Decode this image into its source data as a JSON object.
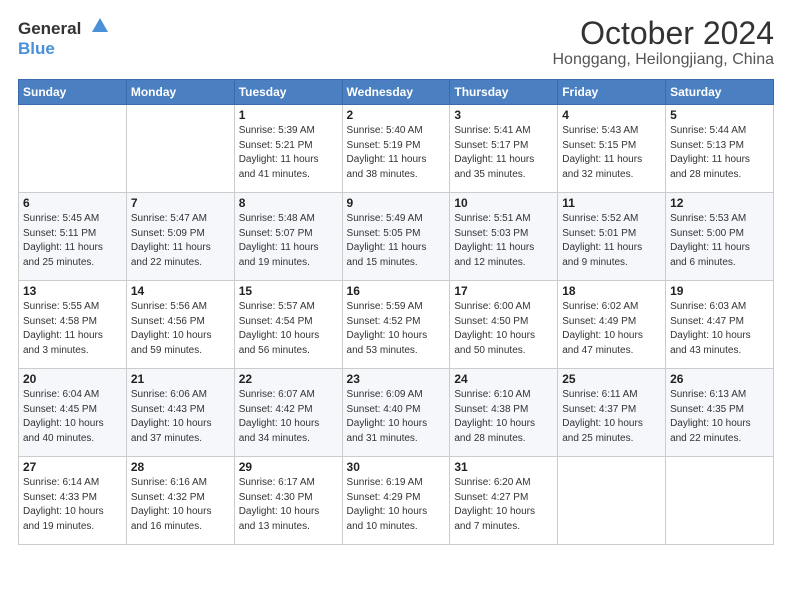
{
  "logo": {
    "text_general": "General",
    "text_blue": "Blue"
  },
  "title": "October 2024",
  "subtitle": "Honggang, Heilongjiang, China",
  "days_of_week": [
    "Sunday",
    "Monday",
    "Tuesday",
    "Wednesday",
    "Thursday",
    "Friday",
    "Saturday"
  ],
  "weeks": [
    [
      {
        "day": "",
        "info": ""
      },
      {
        "day": "",
        "info": ""
      },
      {
        "day": "1",
        "info": "Sunrise: 5:39 AM\nSunset: 5:21 PM\nDaylight: 11 hours and 41 minutes."
      },
      {
        "day": "2",
        "info": "Sunrise: 5:40 AM\nSunset: 5:19 PM\nDaylight: 11 hours and 38 minutes."
      },
      {
        "day": "3",
        "info": "Sunrise: 5:41 AM\nSunset: 5:17 PM\nDaylight: 11 hours and 35 minutes."
      },
      {
        "day": "4",
        "info": "Sunrise: 5:43 AM\nSunset: 5:15 PM\nDaylight: 11 hours and 32 minutes."
      },
      {
        "day": "5",
        "info": "Sunrise: 5:44 AM\nSunset: 5:13 PM\nDaylight: 11 hours and 28 minutes."
      }
    ],
    [
      {
        "day": "6",
        "info": "Sunrise: 5:45 AM\nSunset: 5:11 PM\nDaylight: 11 hours and 25 minutes."
      },
      {
        "day": "7",
        "info": "Sunrise: 5:47 AM\nSunset: 5:09 PM\nDaylight: 11 hours and 22 minutes."
      },
      {
        "day": "8",
        "info": "Sunrise: 5:48 AM\nSunset: 5:07 PM\nDaylight: 11 hours and 19 minutes."
      },
      {
        "day": "9",
        "info": "Sunrise: 5:49 AM\nSunset: 5:05 PM\nDaylight: 11 hours and 15 minutes."
      },
      {
        "day": "10",
        "info": "Sunrise: 5:51 AM\nSunset: 5:03 PM\nDaylight: 11 hours and 12 minutes."
      },
      {
        "day": "11",
        "info": "Sunrise: 5:52 AM\nSunset: 5:01 PM\nDaylight: 11 hours and 9 minutes."
      },
      {
        "day": "12",
        "info": "Sunrise: 5:53 AM\nSunset: 5:00 PM\nDaylight: 11 hours and 6 minutes."
      }
    ],
    [
      {
        "day": "13",
        "info": "Sunrise: 5:55 AM\nSunset: 4:58 PM\nDaylight: 11 hours and 3 minutes."
      },
      {
        "day": "14",
        "info": "Sunrise: 5:56 AM\nSunset: 4:56 PM\nDaylight: 10 hours and 59 minutes."
      },
      {
        "day": "15",
        "info": "Sunrise: 5:57 AM\nSunset: 4:54 PM\nDaylight: 10 hours and 56 minutes."
      },
      {
        "day": "16",
        "info": "Sunrise: 5:59 AM\nSunset: 4:52 PM\nDaylight: 10 hours and 53 minutes."
      },
      {
        "day": "17",
        "info": "Sunrise: 6:00 AM\nSunset: 4:50 PM\nDaylight: 10 hours and 50 minutes."
      },
      {
        "day": "18",
        "info": "Sunrise: 6:02 AM\nSunset: 4:49 PM\nDaylight: 10 hours and 47 minutes."
      },
      {
        "day": "19",
        "info": "Sunrise: 6:03 AM\nSunset: 4:47 PM\nDaylight: 10 hours and 43 minutes."
      }
    ],
    [
      {
        "day": "20",
        "info": "Sunrise: 6:04 AM\nSunset: 4:45 PM\nDaylight: 10 hours and 40 minutes."
      },
      {
        "day": "21",
        "info": "Sunrise: 6:06 AM\nSunset: 4:43 PM\nDaylight: 10 hours and 37 minutes."
      },
      {
        "day": "22",
        "info": "Sunrise: 6:07 AM\nSunset: 4:42 PM\nDaylight: 10 hours and 34 minutes."
      },
      {
        "day": "23",
        "info": "Sunrise: 6:09 AM\nSunset: 4:40 PM\nDaylight: 10 hours and 31 minutes."
      },
      {
        "day": "24",
        "info": "Sunrise: 6:10 AM\nSunset: 4:38 PM\nDaylight: 10 hours and 28 minutes."
      },
      {
        "day": "25",
        "info": "Sunrise: 6:11 AM\nSunset: 4:37 PM\nDaylight: 10 hours and 25 minutes."
      },
      {
        "day": "26",
        "info": "Sunrise: 6:13 AM\nSunset: 4:35 PM\nDaylight: 10 hours and 22 minutes."
      }
    ],
    [
      {
        "day": "27",
        "info": "Sunrise: 6:14 AM\nSunset: 4:33 PM\nDaylight: 10 hours and 19 minutes."
      },
      {
        "day": "28",
        "info": "Sunrise: 6:16 AM\nSunset: 4:32 PM\nDaylight: 10 hours and 16 minutes."
      },
      {
        "day": "29",
        "info": "Sunrise: 6:17 AM\nSunset: 4:30 PM\nDaylight: 10 hours and 13 minutes."
      },
      {
        "day": "30",
        "info": "Sunrise: 6:19 AM\nSunset: 4:29 PM\nDaylight: 10 hours and 10 minutes."
      },
      {
        "day": "31",
        "info": "Sunrise: 6:20 AM\nSunset: 4:27 PM\nDaylight: 10 hours and 7 minutes."
      },
      {
        "day": "",
        "info": ""
      },
      {
        "day": "",
        "info": ""
      }
    ]
  ]
}
